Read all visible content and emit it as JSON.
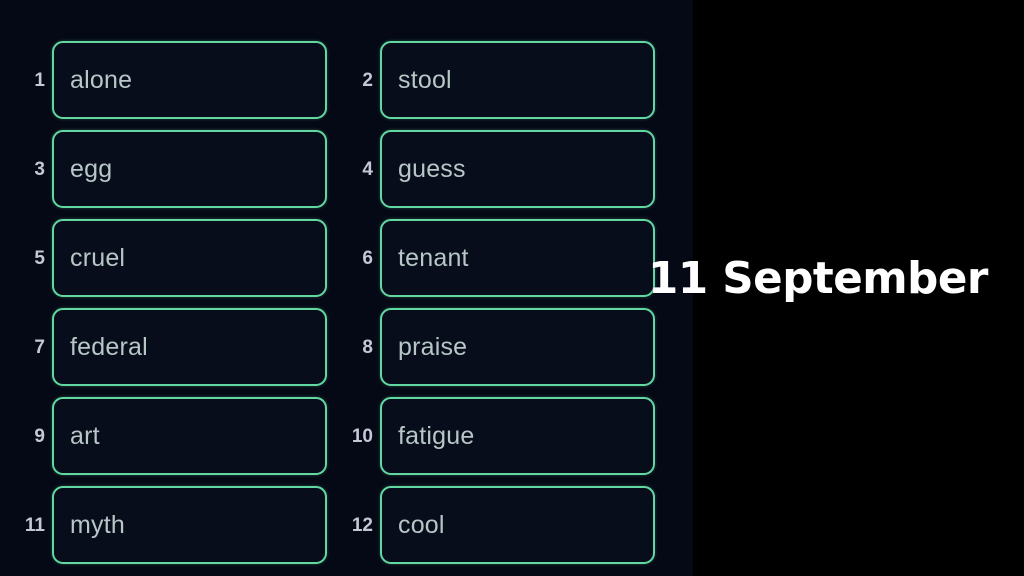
{
  "worksheet": {
    "background_color": "#050916",
    "accent_color": "#62d7a0",
    "word_text_color": "#b7c6c6",
    "index_text_color": "#c3c7d6",
    "items": [
      {
        "index": "1",
        "word": "alone"
      },
      {
        "index": "2",
        "word": "stool"
      },
      {
        "index": "3",
        "word": "egg"
      },
      {
        "index": "4",
        "word": "guess"
      },
      {
        "index": "5",
        "word": "cruel"
      },
      {
        "index": "6",
        "word": "tenant"
      },
      {
        "index": "7",
        "word": "federal"
      },
      {
        "index": "8",
        "word": "praise"
      },
      {
        "index": "9",
        "word": "art"
      },
      {
        "index": "10",
        "word": "fatigue"
      },
      {
        "index": "11",
        "word": "myth"
      },
      {
        "index": "12",
        "word": "cool"
      }
    ]
  },
  "caption": {
    "date_text": "11 September",
    "text_color": "#ffffff",
    "panel_color": "#000000"
  }
}
